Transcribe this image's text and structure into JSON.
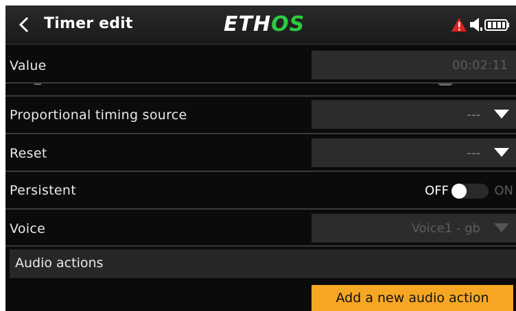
{
  "header": {
    "title": "Timer edit",
    "logo_part1": "ETH",
    "logo_part2": "OS"
  },
  "rows": {
    "value": {
      "label": "Value",
      "value": "00:02:11"
    },
    "proportional": {
      "label": "Proportional timing source",
      "value": "---"
    },
    "reset": {
      "label": "Reset",
      "value": "---"
    },
    "persistent": {
      "label": "Persistent",
      "off_label": "OFF",
      "on_label": "ON",
      "state": "off"
    },
    "voice": {
      "label": "Voice",
      "value": "Voice1 - gb"
    }
  },
  "audio": {
    "section_label": "Audio actions",
    "add_button_label": "Add a new audio action"
  },
  "colors": {
    "accent": "#f5a623",
    "logo_green": "#2ecc40",
    "warning": "#e02020"
  }
}
